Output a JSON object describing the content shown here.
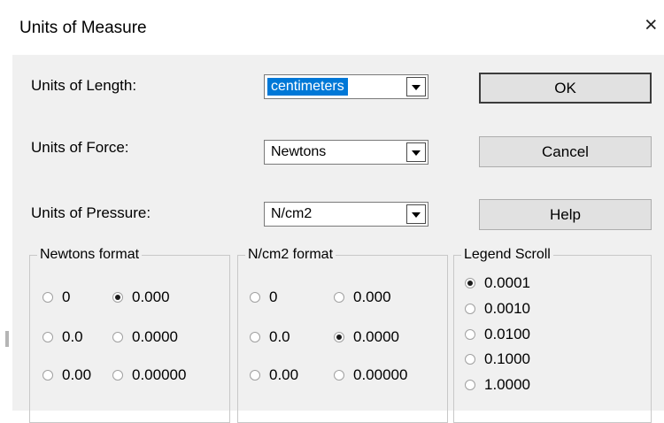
{
  "window": {
    "title": "Units of Measure",
    "close_glyph": "×"
  },
  "rows": {
    "length": {
      "label": "Units of Length:",
      "value": "centimeters"
    },
    "force": {
      "label": "Units of Force:",
      "value": "Newtons"
    },
    "pressure": {
      "label": "Units of Pressure:",
      "value": "N/cm2"
    }
  },
  "buttons": {
    "ok": "OK",
    "cancel": "Cancel",
    "help": "Help"
  },
  "newtons_format": {
    "label": "Newtons format",
    "options": [
      "0",
      "0.000",
      "0.0",
      "0.0000",
      "0.00",
      "0.00000"
    ],
    "selected": "0.000"
  },
  "pressure_format": {
    "label": "N/cm2 format",
    "options": [
      "0",
      "0.000",
      "0.0",
      "0.0000",
      "0.00",
      "0.00000"
    ],
    "selected": "0.0000"
  },
  "legend_scroll": {
    "label": "Legend Scroll",
    "options": [
      "0.0001",
      "0.0010",
      "0.0100",
      "0.1000",
      "1.0000"
    ],
    "selected": "0.0001"
  },
  "colors": {
    "selection": "#0078d7",
    "dialog_bg": "#f0f0f0",
    "button_bg": "#e1e1e1"
  }
}
